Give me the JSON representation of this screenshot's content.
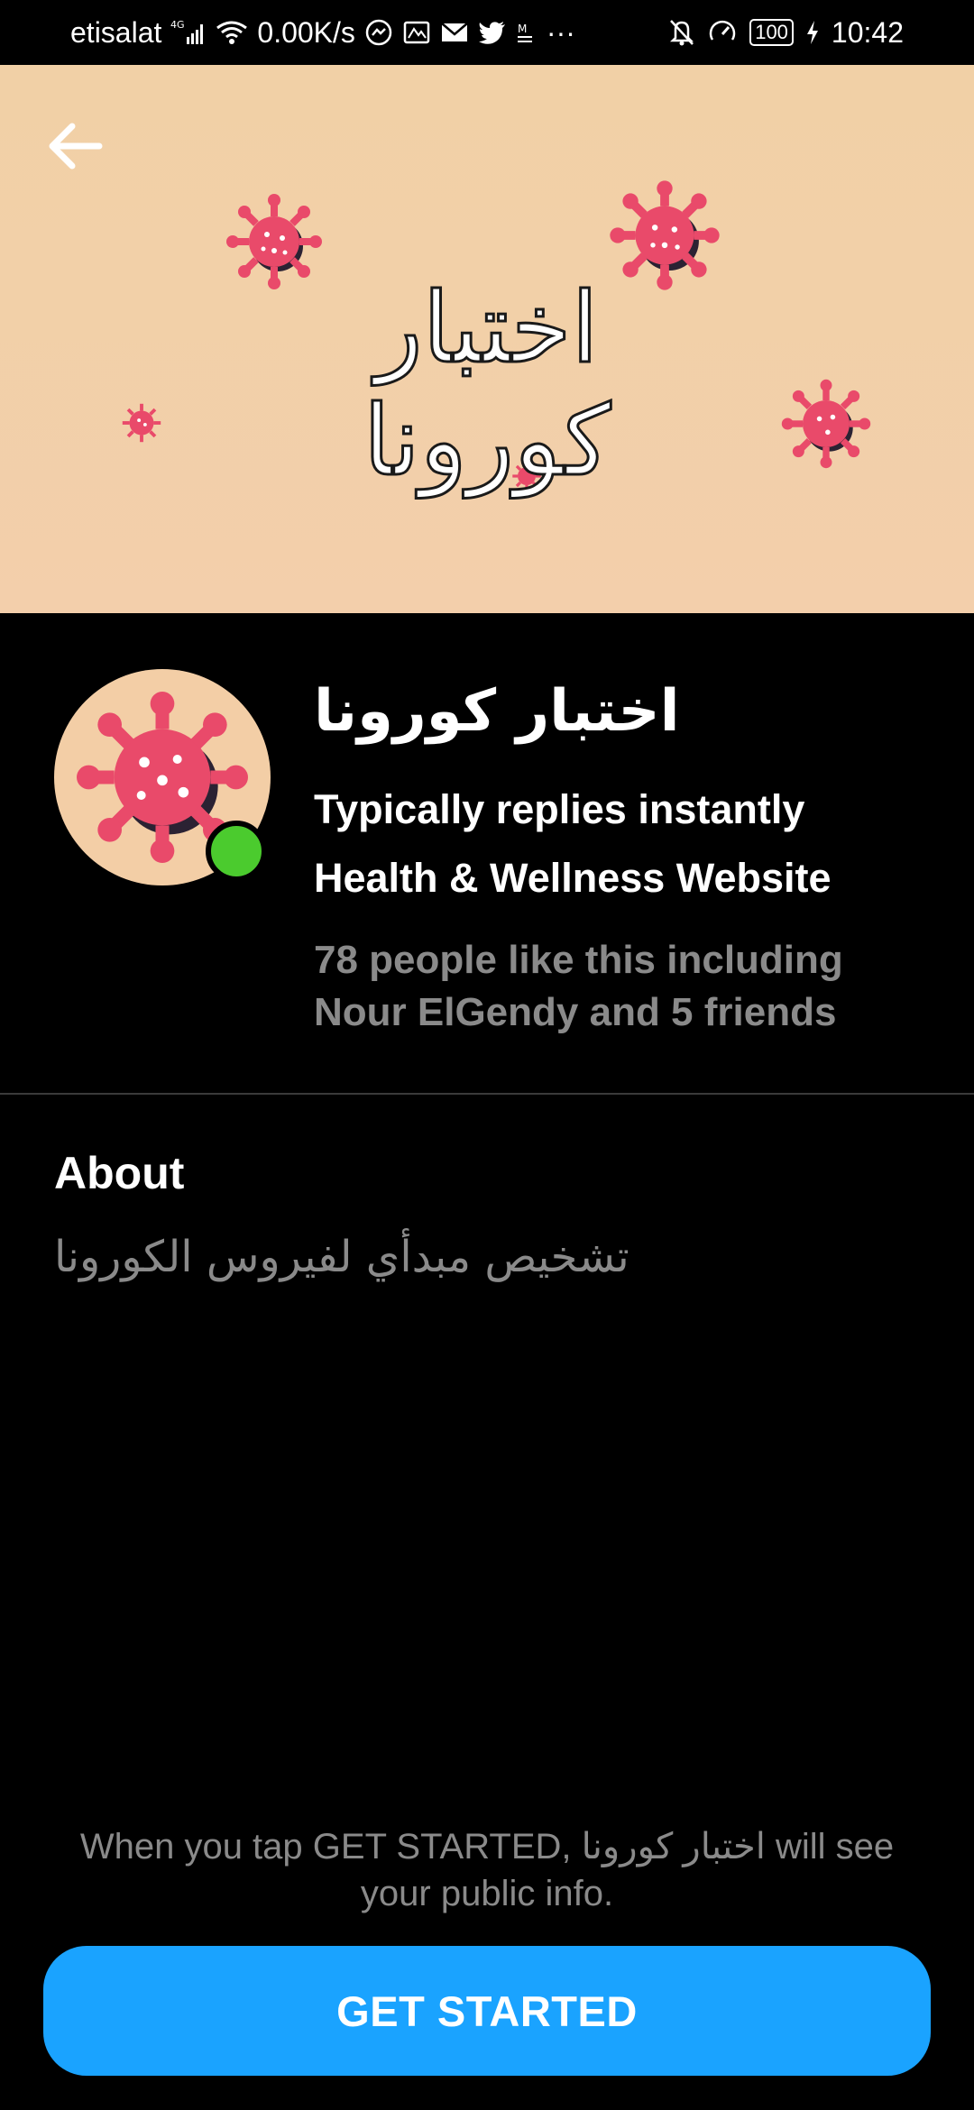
{
  "status_bar": {
    "carrier": "etisalat",
    "network_type": "4G",
    "data_speed": "0.00K/s",
    "more_dots": "···",
    "battery_level": "100",
    "time": "10:42",
    "icons": [
      "signal-icon",
      "wifi-icon",
      "messenger-icon",
      "gallery-icon",
      "mail-icon",
      "twitter-icon",
      "mail-small-icon",
      "silent-bell-icon",
      "speedometer-icon",
      "battery-icon",
      "charging-icon"
    ]
  },
  "cover": {
    "title": "اختبار كورونا",
    "back_icon": "arrow-left-icon"
  },
  "page": {
    "name": "اختبار كورونا",
    "reply_status": "Typically replies instantly",
    "category": "Health & Wellness Website",
    "likes_line1": "78 people like this including",
    "likes_line2": "Nour ElGendy and 5 friends",
    "online": true
  },
  "about": {
    "heading": "About",
    "text": "تشخيص مبدأي لفيروس الكورونا"
  },
  "footer": {
    "consent_part1": "When you tap GET STARTED, ",
    "consent_name": "اختبار كورونا",
    "consent_part2": " will see your public info.",
    "button_label": "GET STARTED"
  },
  "colors": {
    "cover_bg": "#f1d0a6",
    "virus_pink": "#e94a6a",
    "online_green": "#4bcb2e",
    "button_blue": "#1aa3ff",
    "muted_text": "#8a8a8a"
  }
}
